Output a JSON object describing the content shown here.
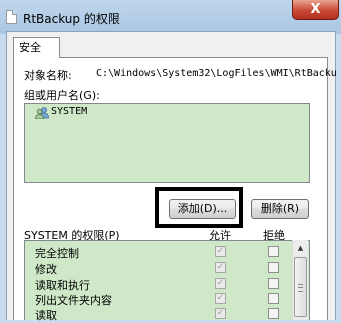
{
  "window": {
    "title": "RtBackup 的权限",
    "close_label": "X"
  },
  "tabs": [
    {
      "label": "安全"
    }
  ],
  "object": {
    "label": "对象名称:",
    "value": "C:\\Windows\\System32\\LogFiles\\WMI\\RtBacku"
  },
  "users": {
    "label": "组或用户名(G):",
    "items": [
      {
        "name": "SYSTEM",
        "icon": "user-group-icon"
      }
    ],
    "add_button": "添加(D)...",
    "remove_button": "删除(R)"
  },
  "permissions": {
    "label": "SYSTEM 的权限(P)",
    "allow_header": "允许",
    "deny_header": "拒绝",
    "rows": [
      {
        "name": "完全控制",
        "allow": true,
        "deny": false
      },
      {
        "name": "修改",
        "allow": true,
        "deny": false
      },
      {
        "name": "读取和执行",
        "allow": true,
        "deny": false
      },
      {
        "name": "列出文件夹内容",
        "allow": true,
        "deny": false
      },
      {
        "name": "读取",
        "allow": true,
        "deny": false
      }
    ]
  },
  "colors": {
    "list_background": "#cfe9c8",
    "title_bar": "#bfd6ec",
    "close_button": "#c94a36",
    "highlight_border": "#000000"
  }
}
